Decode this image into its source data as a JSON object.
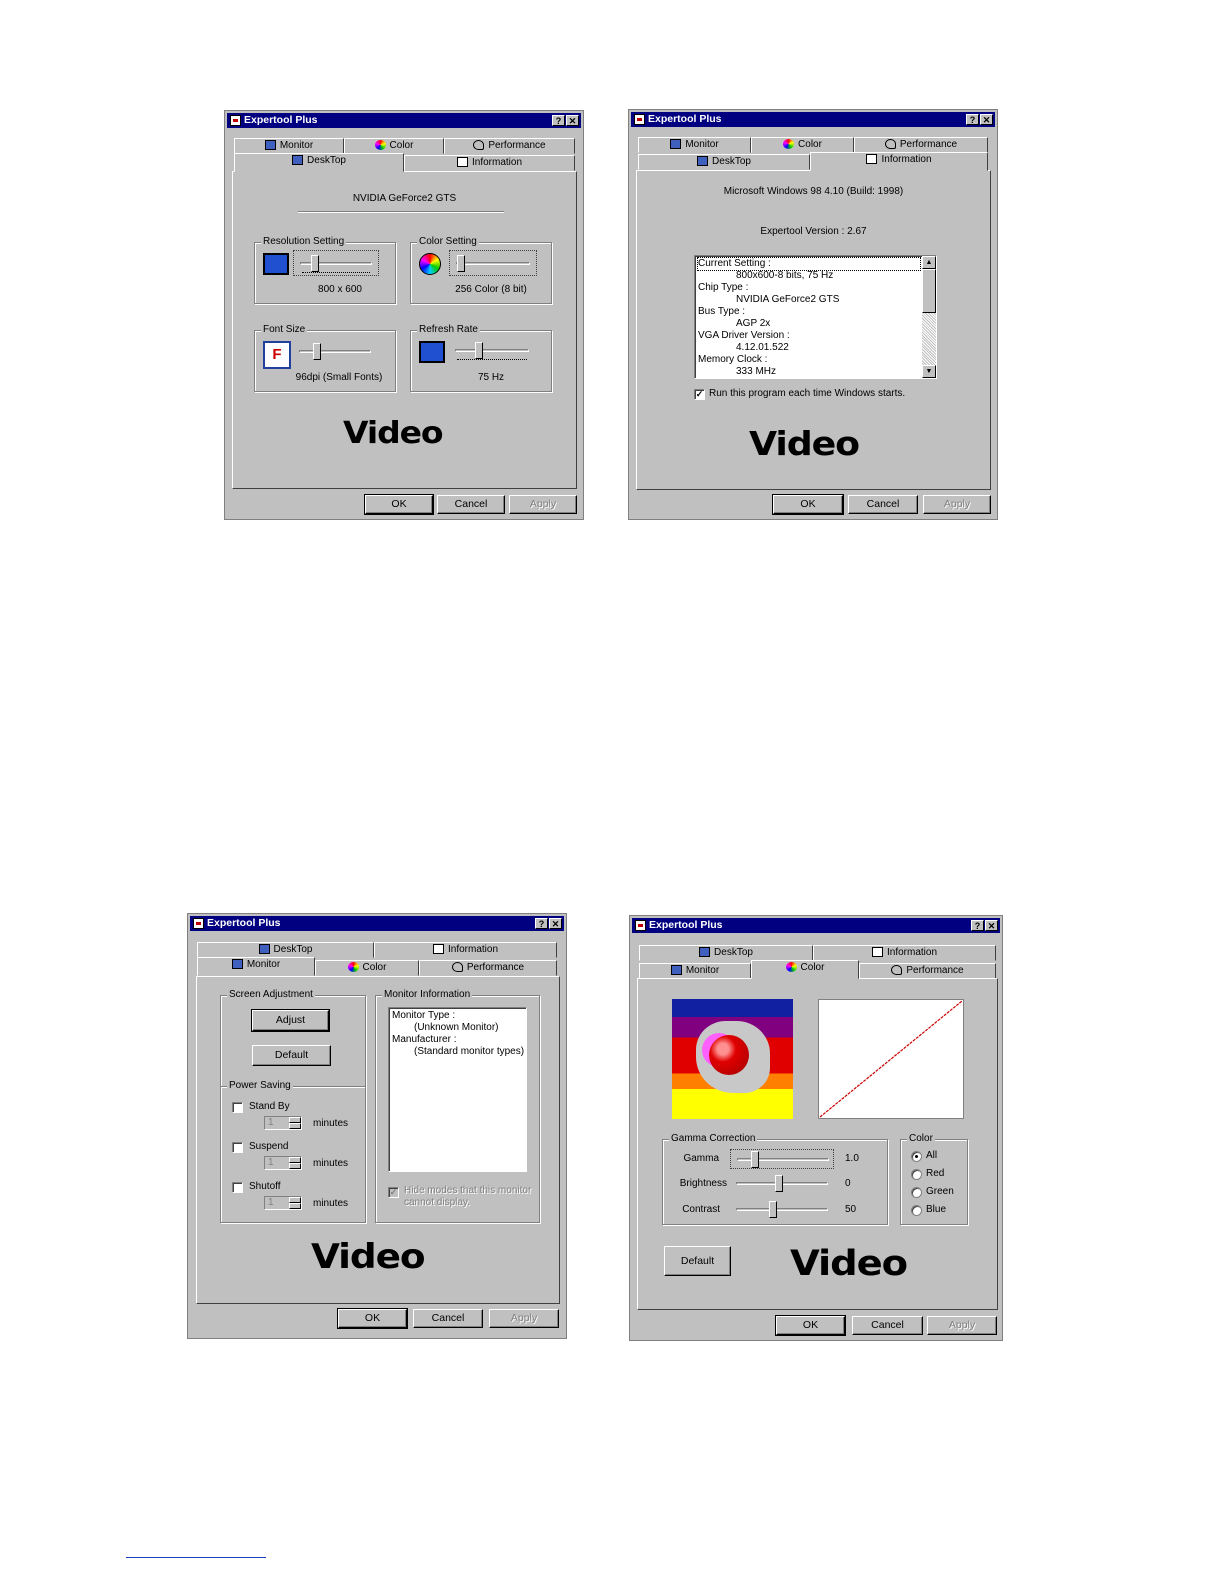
{
  "window_title": "Expertool Plus",
  "title_buttons": {
    "help": "?",
    "close": "✕"
  },
  "tabs": {
    "desktop": "DeskTop",
    "information": "Information",
    "monitor": "Monitor",
    "color": "Color",
    "performance": "Performance"
  },
  "buttons": {
    "ok": "OK",
    "cancel": "Cancel",
    "apply": "Apply"
  },
  "logo_text": "Video",
  "desktop_panel": {
    "chip_name": "NVIDIA GeForce2 GTS",
    "resolution": {
      "label": "Resolution Setting",
      "value": "800 x 600"
    },
    "color_setting": {
      "label": "Color Setting",
      "value": "256 Color (8 bit)"
    },
    "font_size": {
      "label": "Font Size",
      "value": "96dpi (Small Fonts)"
    },
    "refresh_rate": {
      "label": "Refresh Rate",
      "value": "75 Hz"
    }
  },
  "information_panel": {
    "os": "Microsoft Windows 98 4.10 (Build: 1998)",
    "version": "Expertool Version : 2.67",
    "list": [
      {
        "label": "Current Setting :",
        "value": "800x600-8 bits, 75 Hz"
      },
      {
        "label": "Chip Type :",
        "value": "NVIDIA GeForce2 GTS"
      },
      {
        "label": "Bus Type :",
        "value": "AGP 2x"
      },
      {
        "label": "VGA Driver Version :",
        "value": "4.12.01.522"
      },
      {
        "label": "Memory Clock :",
        "value": "333 MHz"
      }
    ],
    "run_at_start": "Run this program each time Windows starts.",
    "run_at_start_checked": true
  },
  "monitor_panel": {
    "screen_adjustment": "Screen Adjustment",
    "adjust": "Adjust",
    "default": "Default",
    "power_saving": "Power Saving",
    "stand_by": "Stand By",
    "suspend": "Suspend",
    "shutoff": "Shutoff",
    "minutes": "minutes",
    "spin_value": "1",
    "monitor_information": "Monitor Information",
    "monitor_type_label": "Monitor Type :",
    "monitor_type_value": "(Unknown Monitor)",
    "manufacturer_label": "Manufacturer :",
    "manufacturer_value": "(Standard monitor types)",
    "hide_modes": "Hide modes that this monitor cannot display."
  },
  "color_panel": {
    "gamma_correction": "Gamma Correction",
    "gamma": {
      "label": "Gamma",
      "value": "1.0"
    },
    "brightness": {
      "label": "Brightness",
      "value": "0"
    },
    "contrast": {
      "label": "Contrast",
      "value": "50"
    },
    "color_group": "Color",
    "options": [
      "All",
      "Red",
      "Green",
      "Blue"
    ],
    "selected": "All",
    "default": "Default"
  },
  "colors": {
    "title_bar": "#000080",
    "face": "#c0c0c0",
    "curve": "#cc0000"
  }
}
